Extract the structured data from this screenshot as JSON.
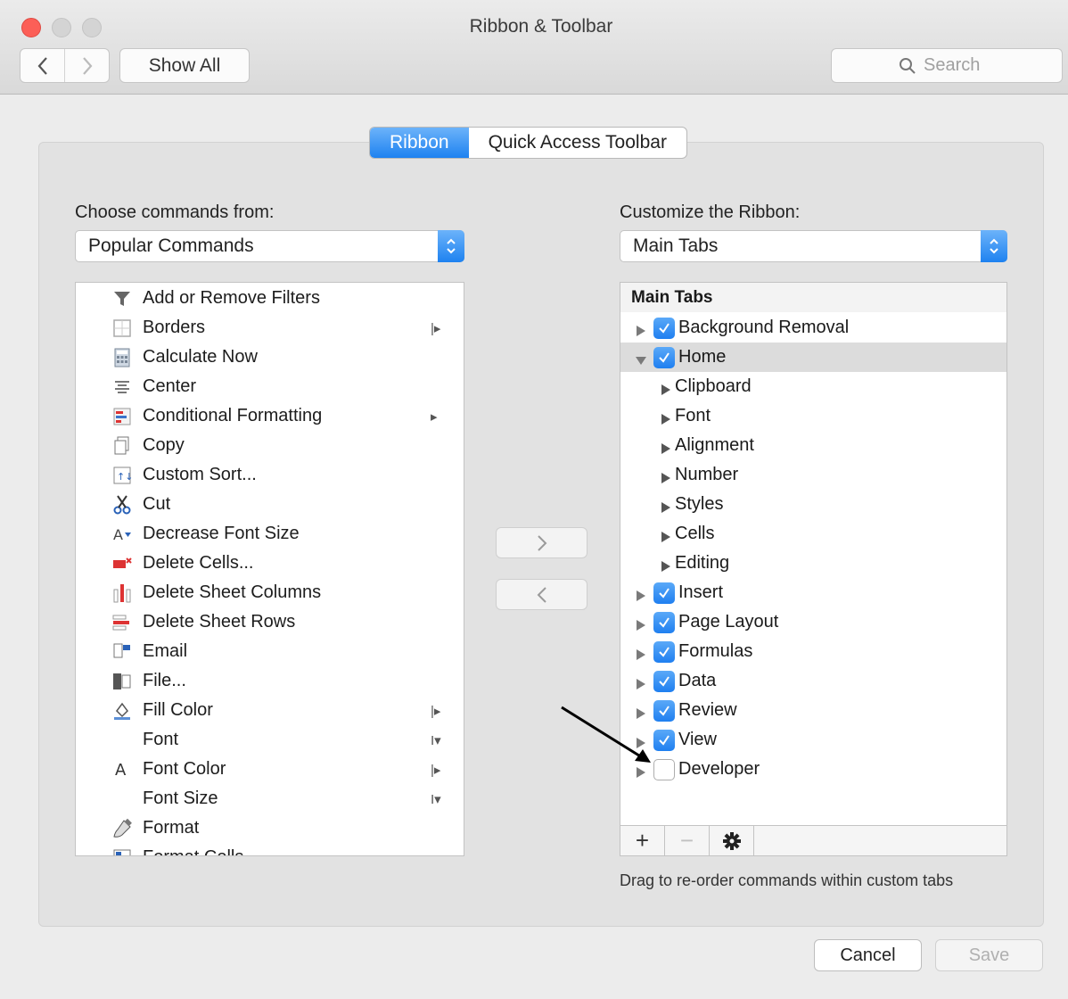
{
  "window": {
    "title": "Ribbon & Toolbar"
  },
  "toolbar": {
    "back": "‹",
    "forward": "›",
    "show_all": "Show All",
    "search_placeholder": "Search"
  },
  "tabs": [
    {
      "label": "Ribbon",
      "active": true
    },
    {
      "label": "Quick Access Toolbar",
      "active": false
    }
  ],
  "left": {
    "label": "Choose commands from:",
    "popup_value": "Popular Commands",
    "commands": [
      {
        "label": "Add or Remove Filters",
        "icon": "filter-icon",
        "sub": ""
      },
      {
        "label": "Borders",
        "icon": "borders-icon",
        "sub": "|▸"
      },
      {
        "label": "Calculate Now",
        "icon": "calculator-icon",
        "sub": ""
      },
      {
        "label": "Center",
        "icon": "align-center-icon",
        "sub": ""
      },
      {
        "label": "Conditional Formatting",
        "icon": "conditional-formatting-icon",
        "sub": "▸"
      },
      {
        "label": "Copy",
        "icon": "copy-icon",
        "sub": ""
      },
      {
        "label": "Custom Sort...",
        "icon": "sort-icon",
        "sub": ""
      },
      {
        "label": "Cut",
        "icon": "scissors-icon",
        "sub": ""
      },
      {
        "label": "Decrease Font Size",
        "icon": "decrease-font-icon",
        "sub": ""
      },
      {
        "label": "Delete Cells...",
        "icon": "delete-cells-icon",
        "sub": ""
      },
      {
        "label": "Delete Sheet Columns",
        "icon": "delete-columns-icon",
        "sub": ""
      },
      {
        "label": "Delete Sheet Rows",
        "icon": "delete-rows-icon",
        "sub": ""
      },
      {
        "label": "Email",
        "icon": "email-icon",
        "sub": ""
      },
      {
        "label": "File...",
        "icon": "file-icon",
        "sub": ""
      },
      {
        "label": "Fill Color",
        "icon": "fill-color-icon",
        "sub": "|▸"
      },
      {
        "label": "Font",
        "icon": "",
        "sub": "I▾"
      },
      {
        "label": "Font Color",
        "icon": "font-color-icon",
        "sub": "|▸"
      },
      {
        "label": "Font Size",
        "icon": "",
        "sub": "I▾"
      },
      {
        "label": "Format",
        "icon": "format-painter-icon",
        "sub": ""
      },
      {
        "label": "Format Cells...",
        "icon": "format-cells-icon",
        "sub": ""
      }
    ]
  },
  "move_buttons": {
    "add": "›",
    "remove": "‹"
  },
  "right": {
    "label": "Customize the Ribbon:",
    "popup_value": "Main Tabs",
    "tree_header": "Main Tabs",
    "items": [
      {
        "label": "Background Removal",
        "level": 0,
        "checked": true,
        "expanded": false
      },
      {
        "label": "Home",
        "level": 0,
        "checked": true,
        "expanded": true
      },
      {
        "label": "Clipboard",
        "level": 1
      },
      {
        "label": "Font",
        "level": 1
      },
      {
        "label": "Alignment",
        "level": 1
      },
      {
        "label": "Number",
        "level": 1
      },
      {
        "label": "Styles",
        "level": 1
      },
      {
        "label": "Cells",
        "level": 1
      },
      {
        "label": "Editing",
        "level": 1
      },
      {
        "label": "Insert",
        "level": 0,
        "checked": true,
        "expanded": false
      },
      {
        "label": "Page Layout",
        "level": 0,
        "checked": true,
        "expanded": false
      },
      {
        "label": "Formulas",
        "level": 0,
        "checked": true,
        "expanded": false
      },
      {
        "label": "Data",
        "level": 0,
        "checked": true,
        "expanded": false
      },
      {
        "label": "Review",
        "level": 0,
        "checked": true,
        "expanded": false
      },
      {
        "label": "View",
        "level": 0,
        "checked": true,
        "expanded": false
      },
      {
        "label": "Developer",
        "level": 0,
        "checked": false,
        "expanded": false
      }
    ],
    "footer": {
      "add": "+",
      "remove": "−",
      "settings": "gear-icon"
    },
    "hint": "Drag to re-order commands within custom tabs"
  },
  "buttons": {
    "cancel": "Cancel",
    "save": "Save"
  },
  "colors": {
    "accent": "#1e82f0",
    "close": "#fc5f57"
  }
}
